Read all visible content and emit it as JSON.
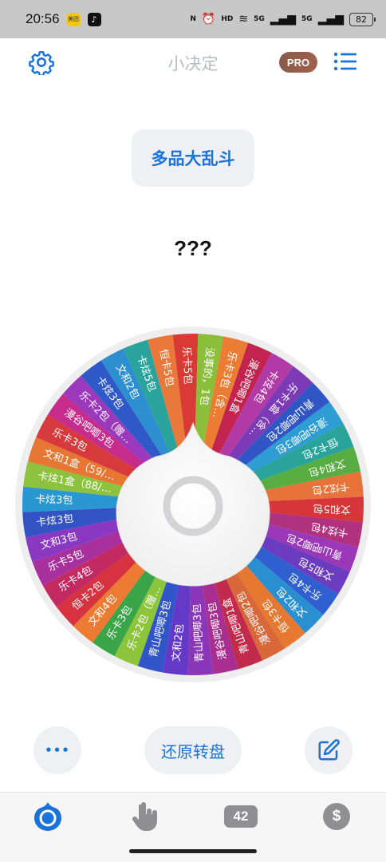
{
  "status": {
    "time": "20:56",
    "app1": "美团",
    "app2": "♪",
    "nfc": "N",
    "hd": "HD",
    "net1": "5G",
    "net2": "5G",
    "battery": "82"
  },
  "header": {
    "title": "小决定",
    "pro_label": "PRO"
  },
  "category": "多品大乱斗",
  "result": "???",
  "wheel": {
    "segments": [
      {
        "label": "乐卡5包",
        "color": "#d93a35"
      },
      {
        "label": "没事的，1包",
        "color": "#8bbf3a"
      },
      {
        "label": "乐卡3包（含…",
        "color": "#ec7b34"
      },
      {
        "label": "漫谷吧唧1盒",
        "color": "#c3234f"
      },
      {
        "label": "卡炫4包",
        "color": "#b23aa6"
      },
      {
        "label": "乐卡1盒（含…",
        "color": "#7d3ab6"
      },
      {
        "label": "青山吧唧2包",
        "color": "#2f56c4"
      },
      {
        "label": "漫谷吧唧3包",
        "color": "#2d9dd3"
      },
      {
        "label": "恒卡2包",
        "color": "#2aa39a"
      },
      {
        "label": "文和4包",
        "color": "#58ad42"
      },
      {
        "label": "卡炫2包",
        "color": "#e8733a"
      },
      {
        "label": "文和5包",
        "color": "#d6353a"
      },
      {
        "label": "卡炫4包",
        "color": "#b0327e"
      },
      {
        "label": "青山吧唧2包",
        "color": "#9a38b8"
      },
      {
        "label": "文和5包",
        "color": "#6b3cc0"
      },
      {
        "label": "乐卡4包",
        "color": "#2f5fd0"
      },
      {
        "label": "文和2包",
        "color": "#2a8fd0"
      },
      {
        "label": "恒卡3包",
        "color": "#e6782f"
      },
      {
        "label": "漫谷吧唧2包",
        "color": "#d8673a"
      },
      {
        "label": "青山吧唧1盒",
        "color": "#c22a4c"
      },
      {
        "label": "漫谷吧唧3包",
        "color": "#a82f8f"
      },
      {
        "label": "青山吧唧3包",
        "color": "#8b36b8"
      },
      {
        "label": "文和2包",
        "color": "#6439c8"
      },
      {
        "label": "青山吧唧3包",
        "color": "#2f55c8"
      },
      {
        "label": "乐卡2包（赠…",
        "color": "#8cc43c"
      },
      {
        "label": "乐卡3包",
        "color": "#3aa548"
      },
      {
        "label": "文和4包",
        "color": "#ec7a32"
      },
      {
        "label": "恒卡2包",
        "color": "#d63240"
      },
      {
        "label": "乐卡4包",
        "color": "#c42a62"
      },
      {
        "label": "乐卡5包",
        "color": "#a8309e"
      },
      {
        "label": "文和3包",
        "color": "#8a38c2"
      },
      {
        "label": "卡炫3包",
        "color": "#3352c4"
      },
      {
        "label": "卡炫3包",
        "color": "#2a97d2"
      },
      {
        "label": "卡炫1盒（88/…",
        "color": "#8cc23e"
      },
      {
        "label": "文和1盒（59/…",
        "color": "#e77632"
      },
      {
        "label": "乐卡3包",
        "color": "#d63a3c"
      },
      {
        "label": "漫谷吧唧3包",
        "color": "#c72b8c"
      },
      {
        "label": "乐卡2包（赠…",
        "color": "#9b38bb"
      },
      {
        "label": "卡炫3包",
        "color": "#2f58c8"
      },
      {
        "label": "文和2包",
        "color": "#2d8fd0"
      },
      {
        "label": "卡炫5包",
        "color": "#2aa39c"
      },
      {
        "label": "恒卡5包",
        "color": "#e9783a"
      }
    ]
  },
  "buttons": {
    "more": "•••",
    "reset": "还原转盘"
  },
  "tabs": {
    "count": "42",
    "dollar": "$"
  },
  "colors": {
    "accent": "#1a73d9",
    "muted": "#8e8e93"
  }
}
